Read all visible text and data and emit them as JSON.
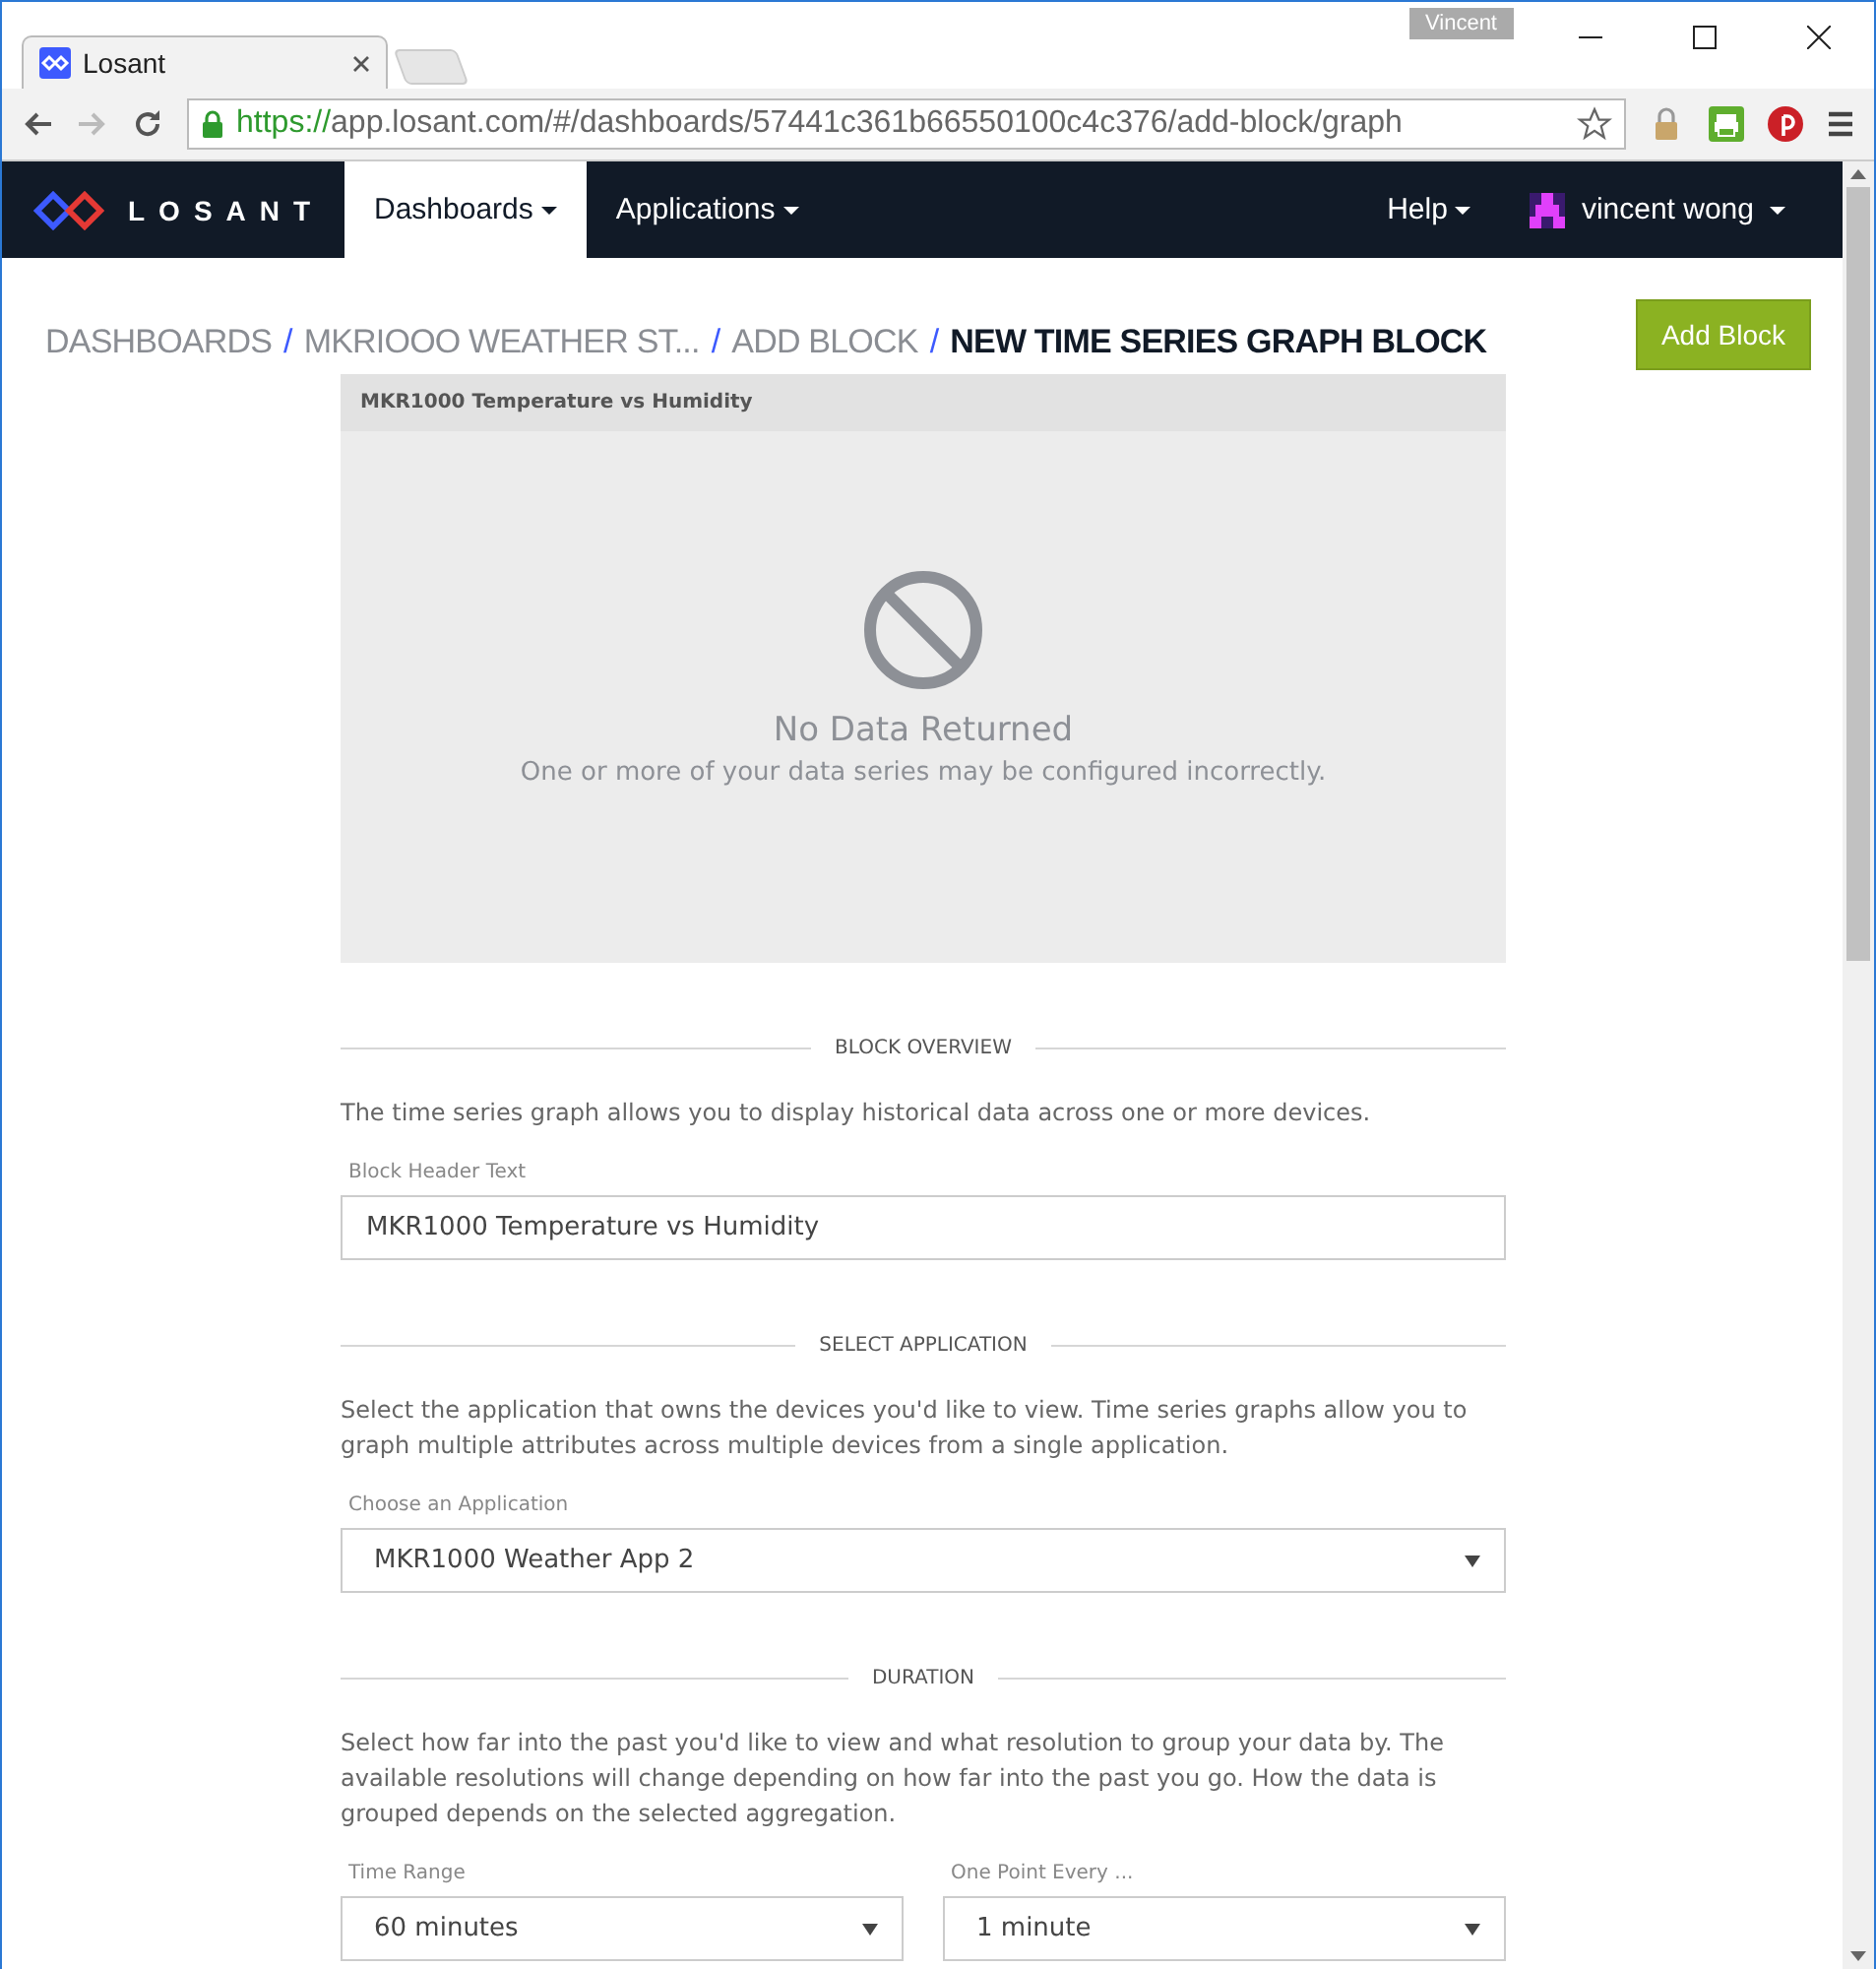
{
  "browser": {
    "tab_title": "Losant",
    "profile": "Vincent",
    "url_scheme": "https://",
    "url_rest": "app.losant.com/#/dashboards/57441c361b66550100c4c376/add-block/graph"
  },
  "navbar": {
    "logo": "LOSANT",
    "menus": [
      {
        "label": "Dashboards",
        "selected": true
      },
      {
        "label": "Applications",
        "selected": false
      }
    ],
    "help": "Help",
    "user": "vincent wong"
  },
  "breadcrumb": [
    {
      "label": "DASHBOARDS",
      "current": false
    },
    {
      "label": "MKRIOOO WEATHER ST...",
      "current": false
    },
    {
      "label": "ADD BLOCK",
      "current": false
    },
    {
      "label": "NEW TIME SERIES GRAPH BLOCK",
      "current": true
    }
  ],
  "separator": "/",
  "add_block_button": "Add Block",
  "preview": {
    "header": "MKR1000 Temperature vs Humidity",
    "empty_title": "No Data Returned",
    "empty_text": "One or more of your data series may be configured incorrectly."
  },
  "sections": [
    {
      "title": "BLOCK OVERVIEW",
      "description": "The time series graph allows you to display historical data across one or more devices.",
      "fields": [
        {
          "kind": "text",
          "label": "Block Header Text",
          "value": "MKR1000 Temperature vs Humidity"
        }
      ]
    },
    {
      "title": "SELECT APPLICATION",
      "description": "Select the application that owns the devices you'd like to view. Time series graphs allow you to graph multiple attributes across multiple devices from a single application.",
      "fields": [
        {
          "kind": "select",
          "label": "Choose an Application",
          "value": "MKR1000 Weather App 2"
        }
      ]
    },
    {
      "title": "DURATION",
      "description": "Select how far into the past you'd like to view and what resolution to group your data by. The available resolutions will change depending on how far into the past you go. How the data is grouped depends on the selected aggregation.",
      "fields": [
        {
          "kind": "select",
          "label": "Time Range",
          "value": "60 minutes"
        },
        {
          "kind": "select",
          "label": "One Point Every ...",
          "value": "1 minute"
        }
      ]
    }
  ]
}
